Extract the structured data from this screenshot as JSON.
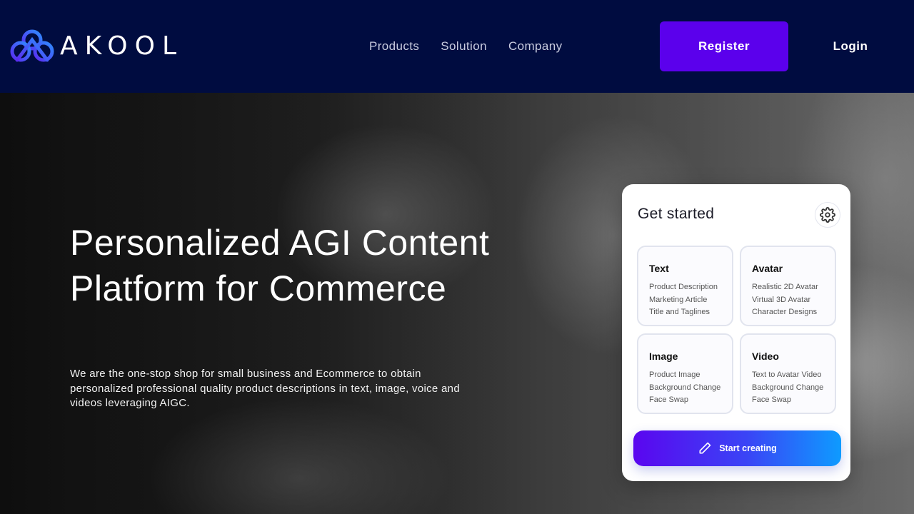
{
  "header": {
    "logo_text": "AKOOL",
    "nav": [
      {
        "label": "Products"
      },
      {
        "label": "Solution"
      },
      {
        "label": "Company"
      }
    ],
    "register_label": "Register",
    "login_label": "Login"
  },
  "hero": {
    "title_line1": "Personalized AGI Content",
    "title_line2": "Platform for Commerce",
    "description": "We are the one-stop shop for small business and Ecommerce to obtain personalized professional quality product descriptions in text, image, voice and videos leveraging AIGC."
  },
  "card": {
    "title": "Get started",
    "settings_icon": "gear-icon",
    "tiles": [
      {
        "title": "Text",
        "lines": [
          "Product Description",
          "Marketing Article",
          "Title and Taglines"
        ]
      },
      {
        "title": "Avatar",
        "lines": [
          "Realistic 2D Avatar",
          "Virtual 3D Avatar",
          "Character Designs"
        ]
      },
      {
        "title": "Image",
        "lines": [
          "Product Image",
          "Background Change",
          "Face Swap"
        ]
      },
      {
        "title": "Video",
        "lines": [
          "Text to Avatar Video",
          "Background Change",
          "Face Swap"
        ]
      }
    ],
    "cta_label": "Start creating",
    "cta_icon": "pencil-icon"
  },
  "colors": {
    "navbar_bg": "#000c40",
    "register_bg": "#5b00ec",
    "cta_gradient_start": "#5a06ef",
    "cta_gradient_end": "#0e9bff"
  }
}
